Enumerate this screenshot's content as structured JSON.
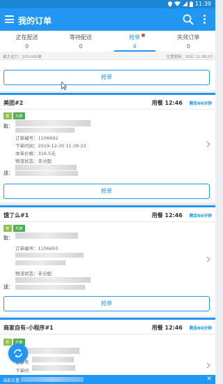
{
  "status_bar": {
    "time": "11:39"
  },
  "app_bar": {
    "title": "我的订单"
  },
  "tabs": [
    {
      "label": "正在配送",
      "count": "0"
    },
    {
      "label": "等待配送",
      "count": "0"
    },
    {
      "label": "抢单",
      "count": "4"
    },
    {
      "label": "失效订单",
      "count": "0"
    }
  ],
  "info": {
    "capacity": "最大运力：100,000单",
    "location_update": "位置更新：30日 11:38:57"
  },
  "top_grab_label": "抢单",
  "orders": [
    {
      "name": "美团#2",
      "meal": "用餐 12:46",
      "remaining": "剩余66分钟",
      "badges": [
        "抢",
        "大单"
      ],
      "pickup_label": "取：",
      "order_no": "订单编号：1106692",
      "order_time": "下单时间：2019-12-30 11:38:33",
      "price": "本单价格：316.5元",
      "logistics": "物流状态：未分配",
      "deliver_label": "送：",
      "grab_label": "抢单"
    },
    {
      "name": "饿了么#1",
      "meal": "用餐 12:46",
      "remaining": "剩余66分钟",
      "badges": [
        "抢",
        "大单"
      ],
      "pickup_label": "取：",
      "order_no": "订单编号：1106693",
      "logistics": "物流状态：未分配",
      "deliver_label": "送：",
      "grab_label": "抢单"
    },
    {
      "name": "商家自有-小程序#1",
      "meal": "用餐 12:46",
      "remaining": "剩余66分钟",
      "badges": [
        "抢",
        "大单"
      ],
      "order_no": "订单号",
      "order_time": "下单时"
    }
  ],
  "bottom_bar": {
    "label": "当前位置："
  },
  "icons": [
    "menu-icon",
    "search-icon",
    "more-icon",
    "chevron-right-icon",
    "refresh-icon",
    "close-icon",
    "wifi-icon",
    "signal-icon",
    "battery-icon",
    "location-icon",
    "cursor-icon"
  ],
  "colors": {
    "primary": "#2196f3",
    "status_bar": "#1b86d6",
    "badge_dot": "#f44336",
    "badge_green": "#8bc34a",
    "badge_dark_green": "#4caf50"
  }
}
